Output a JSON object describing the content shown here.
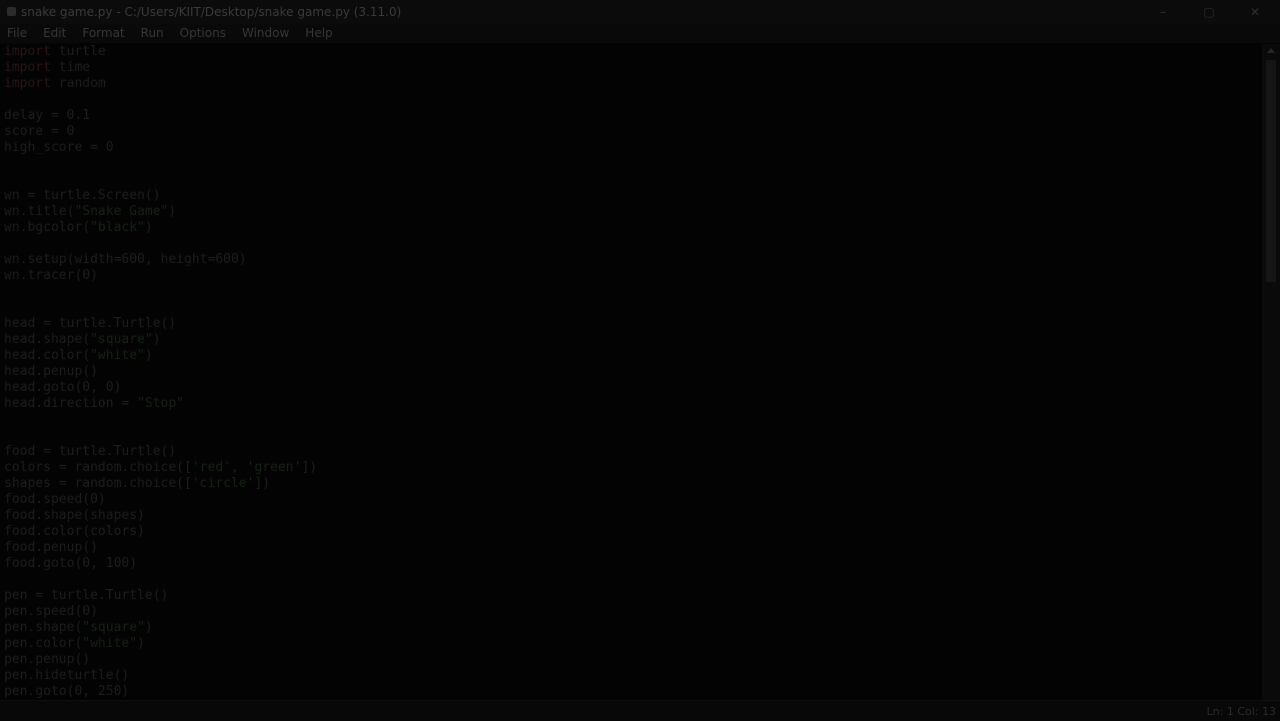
{
  "window": {
    "title": "snake game.py - C:/Users/KIIT/Desktop/snake game.py (3.11.0)",
    "controls": {
      "minimize": "–",
      "maximize": "▢",
      "close": "✕"
    },
    "icons": {
      "app": "python-file-icon"
    }
  },
  "menu": {
    "file": "File",
    "edit": "Edit",
    "format": "Format",
    "run": "Run",
    "options": "Options",
    "window": "Window",
    "help": "Help"
  },
  "editor": {
    "lines": [
      [
        {
          "t": "import",
          "c": "kw"
        },
        {
          "t": " turtle"
        }
      ],
      [
        {
          "t": "import",
          "c": "kw"
        },
        {
          "t": " time"
        }
      ],
      [
        {
          "t": "import",
          "c": "kw"
        },
        {
          "t": " random"
        }
      ],
      [],
      [
        {
          "t": "delay = 0.1"
        }
      ],
      [
        {
          "t": "score = 0"
        }
      ],
      [
        {
          "t": "high_score = 0"
        }
      ],
      [],
      [],
      [
        {
          "t": "wn = turtle.Screen()"
        }
      ],
      [
        {
          "t": "wn.title("
        },
        {
          "t": "\"Snake Game\"",
          "c": "str"
        },
        {
          "t": ")"
        }
      ],
      [
        {
          "t": "wn.bgcolor("
        },
        {
          "t": "\"black\"",
          "c": "str"
        },
        {
          "t": ")"
        }
      ],
      [],
      [
        {
          "t": "wn.setup(width=600, height=600)"
        }
      ],
      [
        {
          "t": "wn.tracer(0)"
        }
      ],
      [],
      [],
      [
        {
          "t": "head = turtle.Turtle()"
        }
      ],
      [
        {
          "t": "head.shape("
        },
        {
          "t": "\"square\"",
          "c": "str"
        },
        {
          "t": ")"
        }
      ],
      [
        {
          "t": "head.color("
        },
        {
          "t": "\"white\"",
          "c": "str"
        },
        {
          "t": ")"
        }
      ],
      [
        {
          "t": "head.penup()"
        }
      ],
      [
        {
          "t": "head.goto(0, 0)"
        }
      ],
      [
        {
          "t": "head.direction = "
        },
        {
          "t": "\"Stop\"",
          "c": "str"
        }
      ],
      [],
      [],
      [
        {
          "t": "food = turtle.Turtle()"
        }
      ],
      [
        {
          "t": "colors = random.choice(["
        },
        {
          "t": "'red'",
          "c": "str"
        },
        {
          "t": ", "
        },
        {
          "t": "'green'",
          "c": "str"
        },
        {
          "t": "])"
        }
      ],
      [
        {
          "t": "shapes = random.choice(["
        },
        {
          "t": "'circle'",
          "c": "str"
        },
        {
          "t": "])"
        }
      ],
      [
        {
          "t": "food.speed(0)"
        }
      ],
      [
        {
          "t": "food.shape(shapes)"
        }
      ],
      [
        {
          "t": "food.color(colors)"
        }
      ],
      [
        {
          "t": "food.penup()"
        }
      ],
      [
        {
          "t": "food.goto(0, 100)"
        }
      ],
      [],
      [
        {
          "t": "pen = turtle.Turtle()"
        }
      ],
      [
        {
          "t": "pen.speed(0)"
        }
      ],
      [
        {
          "t": "pen.shape("
        },
        {
          "t": "\"square\"",
          "c": "str"
        },
        {
          "t": ")"
        }
      ],
      [
        {
          "t": "pen.color("
        },
        {
          "t": "\"white\"",
          "c": "str"
        },
        {
          "t": ")"
        }
      ],
      [
        {
          "t": "pen.penup()"
        }
      ],
      [
        {
          "t": "pen.hideturtle()"
        }
      ],
      [
        {
          "t": "pen.goto(0, 250)"
        }
      ]
    ]
  },
  "status": {
    "position": "Ln: 1   Col: 13"
  },
  "colors": {
    "overlay_bg": "#050505",
    "keyword": "#2a1414",
    "string": "#142214",
    "text": "#1d1d1d"
  }
}
